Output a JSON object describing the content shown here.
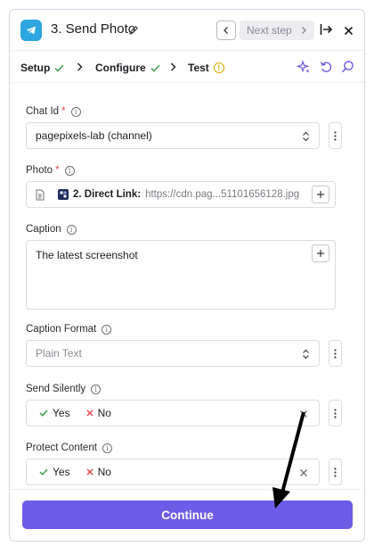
{
  "header": {
    "title": "3. Send Photo",
    "next_label": "Next step",
    "icons": [
      "telegram-logo",
      "pencil-icon",
      "chevron-left-icon",
      "chevron-right-icon",
      "expand-right-icon",
      "close-icon"
    ]
  },
  "steps": {
    "items": [
      {
        "label": "Setup",
        "status": "done"
      },
      {
        "label": "Configure",
        "status": "done"
      },
      {
        "label": "Test",
        "status": "warning"
      }
    ],
    "warning_mark": "!",
    "colors": {
      "done": "#3fa24a",
      "warning": "#d9a400",
      "tools": "#6c5ce7"
    }
  },
  "fields": {
    "chat_id": {
      "label": "Chat Id",
      "required_mark": "*",
      "value": "pagepixels-lab (channel)"
    },
    "photo": {
      "label": "Photo",
      "required_mark": "*",
      "source_label": "2. Direct Link:",
      "value": "https://cdn.pag...51101656128.jpg"
    },
    "caption": {
      "label": "Caption",
      "value": "The latest screenshot"
    },
    "caption_format": {
      "label": "Caption Format",
      "placeholder": "Plain Text"
    },
    "send_silently": {
      "label": "Send Silently",
      "yes": "Yes",
      "no": "No"
    },
    "protect_content": {
      "label": "Protect Content",
      "yes": "Yes",
      "no": "No"
    }
  },
  "info_glyph": "i",
  "footer": {
    "continue_label": "Continue",
    "accent": "#6c5ce7"
  }
}
